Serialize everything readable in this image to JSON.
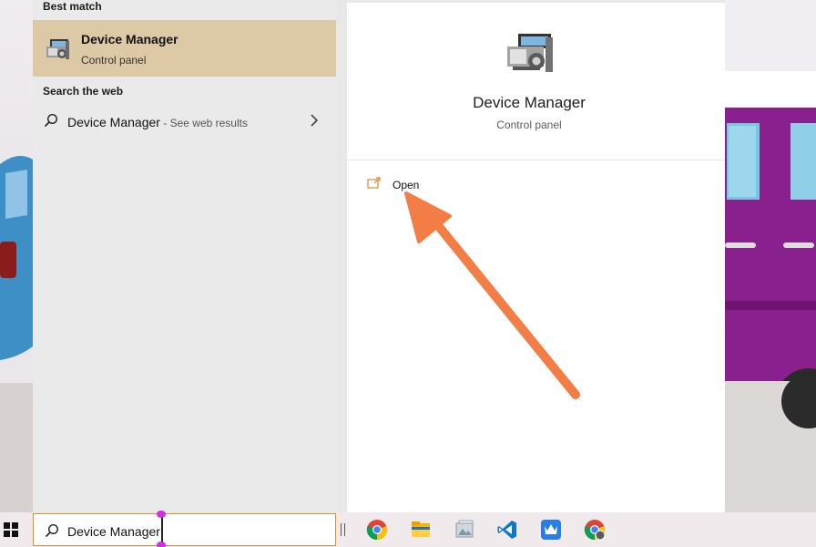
{
  "search_panel": {
    "best_match_heading": "Best match",
    "best_match": {
      "title": "Device Manager",
      "subtitle": "Control panel",
      "icon": "device-manager-icon"
    },
    "web_heading": "Search the web",
    "web_result": {
      "query": "Device Manager",
      "suffix": " - See web results"
    },
    "preview": {
      "title": "Device Manager",
      "subtitle": "Control panel",
      "icon": "device-manager-icon"
    },
    "actions": [
      {
        "label": "Open",
        "icon": "open-icon"
      }
    ]
  },
  "taskbar": {
    "search_value": "Device Manager",
    "apps": [
      "chrome-icon",
      "file-explorer-icon",
      "photos-icon",
      "vscode-icon",
      "kingsoft-icon",
      "chrome-alt-icon"
    ]
  },
  "colors": {
    "selection": "#ddc9a6",
    "search_border": "#e58a2b",
    "annotation_arrow": "#f27d45"
  }
}
